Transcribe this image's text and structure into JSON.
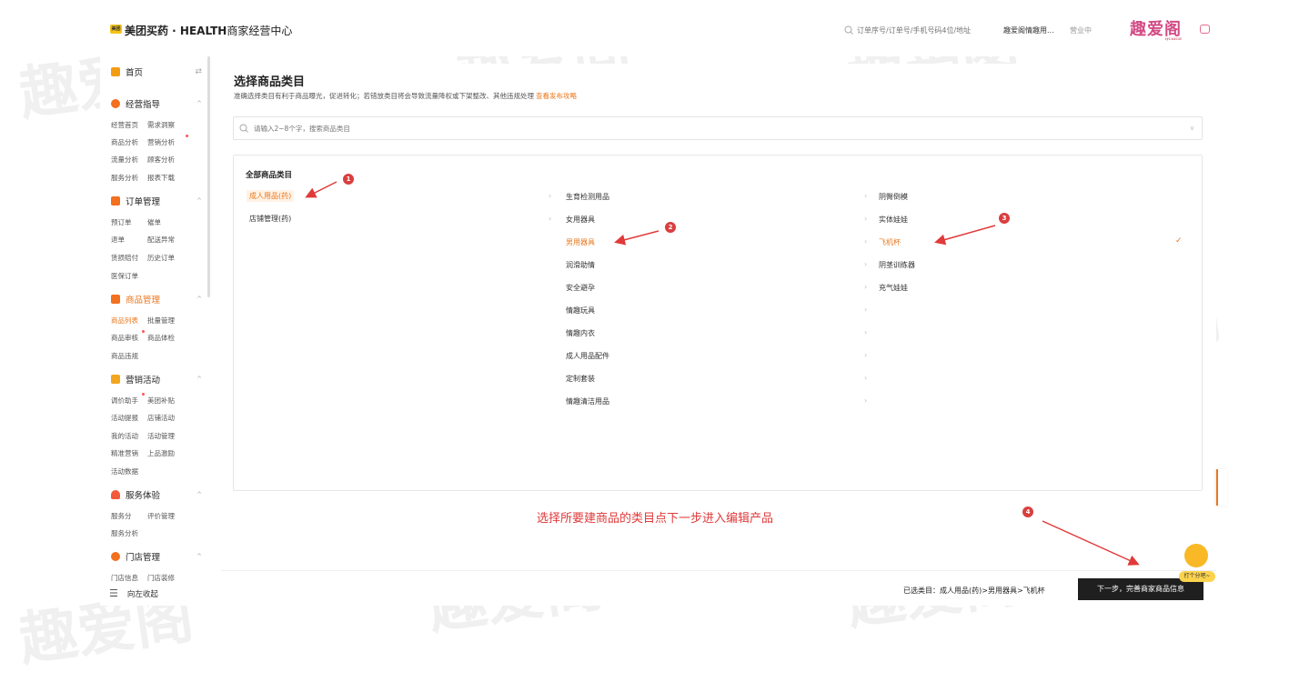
{
  "header": {
    "logo_badge": "美团",
    "app_name": "美团买药 · HEALTH",
    "app_subtitle": "商家经营中心",
    "search_placeholder": "订单序号/订单号/手机号码4位/地址",
    "store_name": "趣爱阁情趣用...",
    "store_status": "营业中",
    "brand_logo": "趣爱阁",
    "brand_logo_sub": "QUAIGE"
  },
  "sidebar": {
    "home": "首页",
    "groups": [
      {
        "label": "经营指导",
        "links": [
          "经营首页",
          "需求洞察",
          "商品分析",
          "营销分析",
          "流量分析",
          "顾客分析",
          "服务分析",
          "报表下载"
        ]
      },
      {
        "label": "订单管理",
        "links": [
          "预订单",
          "催单",
          "退单",
          "配送异常",
          "赁损赔付",
          "历史订单",
          "医保订单"
        ]
      },
      {
        "label": "商品管理",
        "links": [
          "商品列表",
          "批量管理",
          "商品审核",
          "商品体检",
          "商品违规"
        ]
      },
      {
        "label": "营销活动",
        "links": [
          "调价助手",
          "美团补贴",
          "活动提报",
          "店铺活动",
          "我的活动",
          "活动管理",
          "精准营销",
          "上品激励",
          "活动数据"
        ]
      },
      {
        "label": "服务体验",
        "links": [
          "服务分",
          "评价管理",
          "服务分析"
        ]
      },
      {
        "label": "门店管理",
        "links": [
          "门店信息",
          "门店装修"
        ]
      }
    ],
    "collapse_label": "向左收起"
  },
  "main": {
    "title": "选择商品类目",
    "description": "准确选择类目有利于商品曝光，促进转化；若错放类目将会导致流量降权或下架整改、其他违规处理",
    "description_link": "查看发布攻略",
    "search_placeholder": "请输入2~8个字，搜索商品类目",
    "column_title": "全部商品类目",
    "level1": [
      "成人用品(药)",
      "店铺管理(药)"
    ],
    "level2": [
      "生育检测用品",
      "女用器具",
      "男用器具",
      "润滑助情",
      "安全避孕",
      "情趣玩具",
      "情趣内衣",
      "成人用品配件",
      "定制套装",
      "情趣清洁用品"
    ],
    "level3": [
      "阴臀倒模",
      "实体娃娃",
      "飞机杯",
      "阴茎训练器",
      "充气娃娃"
    ]
  },
  "annotations": {
    "numbers": [
      "1",
      "2",
      "3",
      "4"
    ],
    "caption": "选择所要建商品的类目点下一步进入编辑产品",
    "arrow_color": "#e03a3a"
  },
  "footer": {
    "selected_path": "已选类目：成人用品(药)>男用器具>飞机杯",
    "next_button": "下一步，完善商家商品信息",
    "mascot_bubble": "打个分吧~"
  },
  "watermark": {
    "text": "趣爱阁",
    "sub": "QUAIGE"
  },
  "colors": {
    "accent": "#e8771e",
    "annotation": "#d93f3f",
    "button_bg": "#1f1f1f"
  }
}
